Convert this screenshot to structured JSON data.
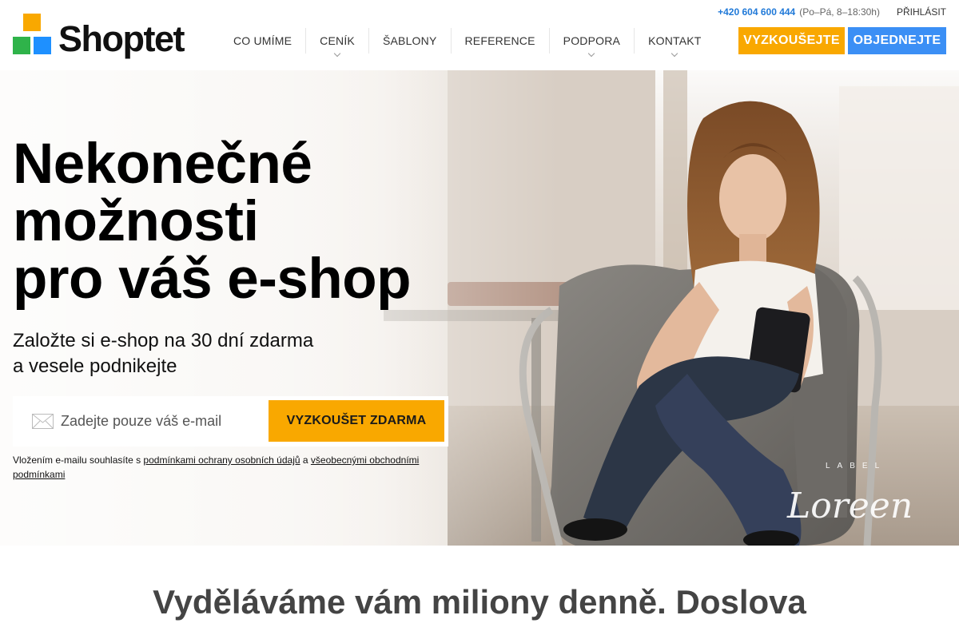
{
  "header": {
    "logo_text": "Shoptet",
    "phone": "+420 604 600 444",
    "hours": "(Po–Pá, 8–18:30h)",
    "login_label": "PŘIHLÁSIT",
    "nav": [
      {
        "label": "CO UMÍME",
        "dropdown": false
      },
      {
        "label": "CENÍK",
        "dropdown": true
      },
      {
        "label": "ŠABLONY",
        "dropdown": false
      },
      {
        "label": "REFERENCE",
        "dropdown": false
      },
      {
        "label": "PODPORA",
        "dropdown": true
      },
      {
        "label": "KONTAKT",
        "dropdown": true
      }
    ],
    "try_label": "VYZKOUŠEJTE",
    "order_label": "OBJEDNEJTE"
  },
  "hero": {
    "title_lines": [
      "Nekonečné",
      "možnosti",
      "pro váš e-shop"
    ],
    "subtitle_lines": [
      "Založte si e-shop na 30 dní zdarma",
      "a vesele podnikejte"
    ],
    "email_placeholder": "Zadejte pouze váš e-mail",
    "submit_label": "VYZKOUŠET ZDARMA",
    "consent": {
      "prefix": "Vložením e-mailu souhlasíte s",
      "privacy_link": "podmínkami ochrany osobních údajů",
      "conjunction": "a",
      "terms_link": "všeobecnými obchodními podmínkami"
    },
    "brand_watermark": {
      "script": "Loreen",
      "caps": "LABEL"
    }
  },
  "section": {
    "heading": "Vyděláváme vám miliony denně. Doslova"
  },
  "colors": {
    "accent_orange": "#f9a800",
    "accent_blue": "#3b8ff5",
    "phone_blue": "#2079d8",
    "logo_yellow": "#f9a800",
    "logo_green": "#2fb34a",
    "logo_blue": "#1e90ff"
  },
  "icons": {
    "email_field": "envelope-icon",
    "dropdown": "chevron-down-icon"
  }
}
